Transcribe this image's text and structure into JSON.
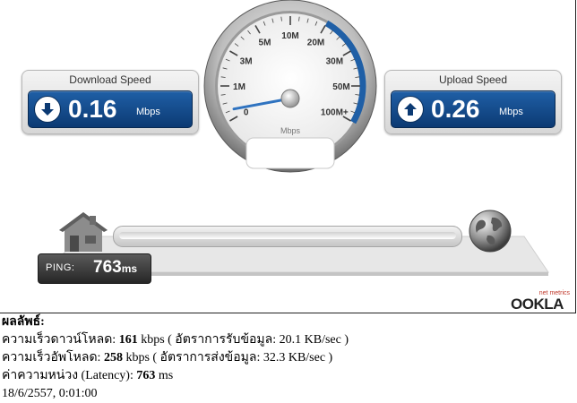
{
  "test": {
    "download_title": "Download Speed",
    "download_value": "0.16",
    "download_unit": "Mbps",
    "upload_title": "Upload Speed",
    "upload_value": "0.26",
    "upload_unit": "Mbps"
  },
  "gauge": {
    "tick_labels": [
      "0",
      "1M",
      "3M",
      "5M",
      "10M",
      "20M",
      "30M",
      "50M",
      "100M+"
    ],
    "unit": "Mbps",
    "needle_mbps": 0.26,
    "accent_color": "#1f5fa6"
  },
  "ping": {
    "label": "PING:",
    "value": "763",
    "unit": "ms"
  },
  "logo": {
    "small": "net metrics",
    "main": "OOKLA"
  },
  "results": {
    "heading": "ผลลัพธ์:",
    "download_prefix": "ความเร็วดาวน์โหลด: ",
    "download_value": "161",
    "download_suffix": " kbps ( อัตราการรับข้อมูล: 20.1 KB/sec )",
    "upload_prefix": "ความเร็วอัพโหลด: ",
    "upload_value": "258",
    "upload_suffix": " kbps ( อัตราการส่งข้อมูล: 32.3 KB/sec )",
    "latency_prefix": "ค่าความหน่วง (Latency): ",
    "latency_value": "763",
    "latency_suffix": " ms",
    "timestamp": "18/6/2557, 0:01:00"
  },
  "icons": {
    "download": "arrow-down-icon",
    "upload": "arrow-up-icon",
    "home": "house-icon",
    "server": "globe-icon"
  }
}
